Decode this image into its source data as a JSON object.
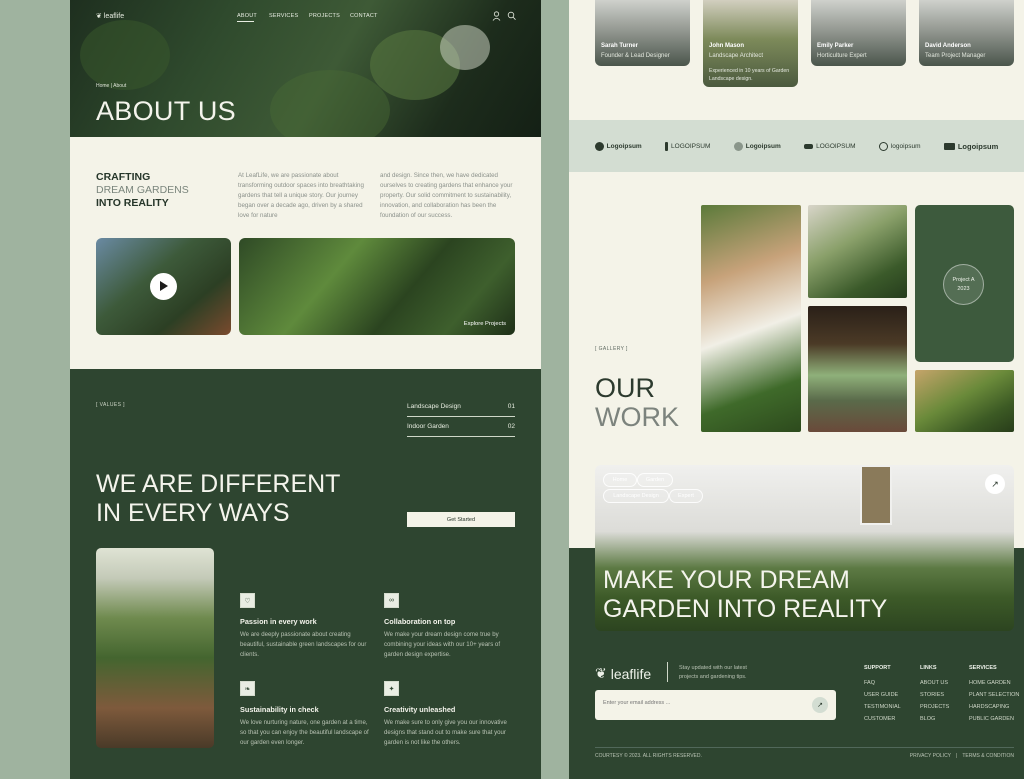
{
  "colors": {
    "dark_green": "#2e4530",
    "cream": "#f4f3e8",
    "mint": "#d3ddd2"
  },
  "nav": {
    "logo": "leaflife",
    "links": [
      "ABOUT",
      "SERVICES",
      "PROJECTS",
      "CONTACT"
    ]
  },
  "hero": {
    "breadcrumb": "Home  |  About",
    "title": "ABOUT US"
  },
  "intro": {
    "heading_1": "CRAFTING",
    "heading_2": "DREAM GARDENS",
    "heading_3": "INTO REALITY",
    "para_1": "At LeafLife, we are passionate about transforming outdoor spaces into breathtaking gardens that tell a unique story. Our journey began over a decade ago, driven by a shared love for nature",
    "para_2": "and design. Since then, we have dedicated ourselves to creating gardens that enhance your property. Our solid commitment to sustainability, innovation, and collaboration has been the foundation of our success.",
    "explore": "Explore Projects"
  },
  "values": {
    "tag": "[   VALUES   ]",
    "rows": [
      {
        "label": "Landscape Design",
        "num": "01"
      },
      {
        "label": "Indoor Garden",
        "num": "02"
      }
    ],
    "title_1": "WE ARE DIFFERENT",
    "title_2": "IN EVERY WAYS",
    "cta": "Get Started",
    "features": [
      {
        "icon": "heart-icon",
        "glyph": "♡",
        "title": "Passion in every work",
        "desc": "We are deeply passionate about creating beautiful, sustainable green landscapes for our clients."
      },
      {
        "icon": "link-icon",
        "glyph": "∞",
        "title": "Collaboration on top",
        "desc": "We make your dream design come true by combining your ideas with our 10+ years of garden design expertise."
      },
      {
        "icon": "leaf-icon",
        "glyph": "❧",
        "title": "Sustainability in check",
        "desc": "We love nurturing nature, one garden at a time, so that you can enjoy the beautiful landscape of our garden even longer."
      },
      {
        "icon": "sparkle-icon",
        "glyph": "✦",
        "title": "Creativity unleashed",
        "desc": "We make sure to only give you our innovative designs that stand out to make sure that your garden is not like the others."
      }
    ]
  },
  "team": [
    {
      "name": "Sarah Turner",
      "role": "Founder & Lead Designer",
      "note": ""
    },
    {
      "name": "John Mason",
      "role": "Landscape Architect",
      "note": "Experienced in 10 years of Garden Landscape design."
    },
    {
      "name": "Emily Parker",
      "role": "Horticulture Expert",
      "note": ""
    },
    {
      "name": "David Anderson",
      "role": "Team Project Manager",
      "note": ""
    }
  ],
  "logos": [
    "Logoipsum",
    "LOGOIPSUM",
    "Logoipsum",
    "LOGOIPSUM",
    "logoipsum",
    "Logoipsum"
  ],
  "gallery": {
    "tag": "[   GALLERY   ]",
    "title_1": "OUR",
    "title_2": "WORK",
    "project_label": "Project A",
    "project_year": "2023"
  },
  "banner": {
    "chips": [
      "Home",
      "Garden",
      "Landscape Design",
      "Expert"
    ],
    "title_1": "MAKE YOUR DREAM",
    "title_2": "GARDEN INTO REALITY"
  },
  "footer": {
    "logo": "leaflife",
    "tagline": "Stay updated with our latest projects and gardening tips.",
    "email_placeholder": "Enter your email address ...",
    "columns": [
      {
        "heading": "SUPPORT",
        "items": [
          "FAQ",
          "USER GUIDE",
          "TESTIMONIAL",
          "CUSTOMER"
        ]
      },
      {
        "heading": "LINKS",
        "items": [
          "ABOUT US",
          "STORIES",
          "PROJECTS",
          "BLOG"
        ]
      },
      {
        "heading": "SERVICES",
        "items": [
          "HOME GARDEN",
          "PLANT SELECTION",
          "HARDSCAPING",
          "PUBLIC GARDEN"
        ]
      }
    ],
    "copyright": "COURTESY © 2023. ALL RIGHTS RESERVED.",
    "privacy": "PRIVACY POLICY",
    "sep": "|",
    "terms": "TERMS & CONDITION"
  }
}
